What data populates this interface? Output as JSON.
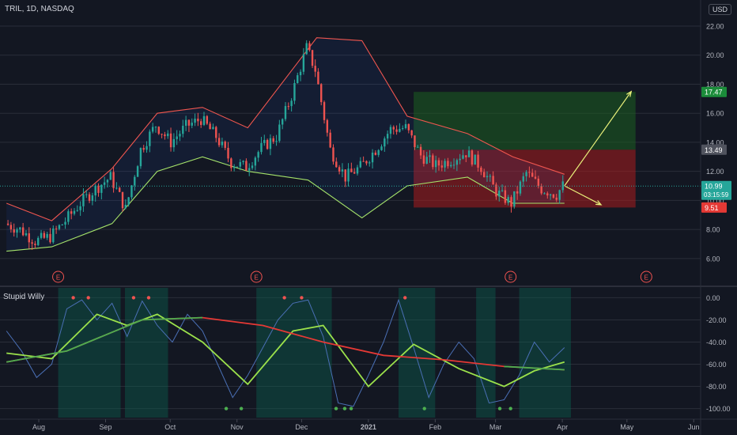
{
  "header": {
    "symbol": "TRIL, 1D, NASDAQ",
    "currency": "USD"
  },
  "indicator": {
    "title": "Stupid Willy"
  },
  "price_badges": {
    "target": "17.47",
    "level": "13.49",
    "current": "10.99",
    "countdown": "03:15:59",
    "stop": "9.51"
  },
  "earnings_marker": "E",
  "x_axis": {
    "labels": [
      "Aug",
      "Sep",
      "Oct",
      "Nov",
      "Dec",
      "2021",
      "Feb",
      "Mar",
      "Apr",
      "May",
      "Jun"
    ]
  },
  "colors": {
    "background": "#131722",
    "up": "#26a69a",
    "down": "#ef5350",
    "upper_band": "#f0564f",
    "lower_band": "#a5e36a",
    "target_zone": "#1b5e20",
    "stop_zone": "#b71c1c",
    "willy_line": "#4a6fb5",
    "grid": "#2a2e39"
  },
  "chart_data": [
    {
      "type": "candlestick",
      "title": "TRIL, 1D, NASDAQ",
      "y_axis_ticks": [
        "22.00",
        "20.00",
        "18.00",
        "16.00",
        "14.00",
        "12.00",
        "10.00",
        "8.00",
        "6.00"
      ],
      "ylim": [
        5.5,
        22.6
      ],
      "x_ticks": [
        "Aug",
        "Sep",
        "Oct",
        "Nov",
        "Dec",
        "2021",
        "Feb",
        "Mar",
        "Apr",
        "May",
        "Jun"
      ],
      "close_path": [
        [
          "2020-07-17",
          8.4
        ],
        [
          "2020-07-24",
          8.0
        ],
        [
          "2020-07-31",
          7.2
        ],
        [
          "2020-08-07",
          7.5
        ],
        [
          "2020-08-14",
          8.6
        ],
        [
          "2020-08-21",
          9.8
        ],
        [
          "2020-08-28",
          10.8
        ],
        [
          "2020-09-04",
          11.6
        ],
        [
          "2020-09-11",
          9.4
        ],
        [
          "2020-09-18",
          13.5
        ],
        [
          "2020-09-25",
          15.2
        ],
        [
          "2020-10-02",
          14.0
        ],
        [
          "2020-10-09",
          15.1
        ],
        [
          "2020-10-16",
          15.6
        ],
        [
          "2020-10-23",
          14.4
        ],
        [
          "2020-10-30",
          12.6
        ],
        [
          "2020-11-06",
          12.3
        ],
        [
          "2020-11-13",
          13.6
        ],
        [
          "2020-11-20",
          14.4
        ],
        [
          "2020-11-27",
          17.2
        ],
        [
          "2020-12-04",
          20.5
        ],
        [
          "2020-12-08",
          19.0
        ],
        [
          "2020-12-15",
          13.5
        ],
        [
          "2020-12-22",
          11.6
        ],
        [
          "2020-12-29",
          12.3
        ],
        [
          "2021-01-05",
          13.5
        ],
        [
          "2021-01-12",
          14.9
        ],
        [
          "2021-01-19",
          15.0
        ],
        [
          "2021-01-26",
          13.1
        ],
        [
          "2021-02-02",
          12.4
        ],
        [
          "2021-02-09",
          12.8
        ],
        [
          "2021-02-16",
          13.3
        ],
        [
          "2021-02-23",
          12.3
        ],
        [
          "2021-03-02",
          10.6
        ],
        [
          "2021-03-09",
          9.8
        ],
        [
          "2021-03-16",
          11.9
        ],
        [
          "2021-03-23",
          10.8
        ],
        [
          "2021-03-30",
          10.4
        ],
        [
          "2021-04-02",
          11.0
        ]
      ],
      "upper_band": [
        [
          "2020-07-17",
          9.8
        ],
        [
          "2020-08-07",
          8.6
        ],
        [
          "2020-09-04",
          12.2
        ],
        [
          "2020-09-25",
          16.0
        ],
        [
          "2020-10-16",
          16.4
        ],
        [
          "2020-11-06",
          15.0
        ],
        [
          "2020-12-08",
          21.2
        ],
        [
          "2020-12-29",
          21.0
        ],
        [
          "2021-01-19",
          15.8
        ],
        [
          "2021-02-16",
          14.6
        ],
        [
          "2021-03-09",
          13.0
        ],
        [
          "2021-04-02",
          11.8
        ]
      ],
      "lower_band": [
        [
          "2020-07-17",
          6.5
        ],
        [
          "2020-08-07",
          6.8
        ],
        [
          "2020-09-04",
          8.4
        ],
        [
          "2020-09-25",
          12.0
        ],
        [
          "2020-10-16",
          13.0
        ],
        [
          "2020-11-06",
          12.0
        ],
        [
          "2020-12-04",
          11.4
        ],
        [
          "2020-12-29",
          8.8
        ],
        [
          "2021-01-19",
          11.0
        ],
        [
          "2021-02-16",
          11.6
        ],
        [
          "2021-03-09",
          9.8
        ],
        [
          "2021-04-02",
          9.8
        ]
      ],
      "position": {
        "entry": 13.49,
        "target": 17.47,
        "stop": 9.51,
        "start": "2021-01-22",
        "end": "2021-05-05",
        "projection_up": [
          [
            "2021-04-02",
            11.0
          ],
          [
            "2021-05-03",
            17.5
          ]
        ],
        "projection_down": [
          [
            "2021-04-02",
            11.0
          ],
          [
            "2021-04-19",
            9.7
          ]
        ]
      },
      "earnings_dates": [
        "2020-08-10",
        "2020-11-10",
        "2021-03-08",
        "2021-05-10"
      ],
      "last_price": 10.99,
      "countdown": "03:15:59"
    },
    {
      "type": "line",
      "title": "Stupid Willy",
      "y_axis_ticks": [
        "0.00",
        "-20.00",
        "-40.00",
        "-60.00",
        "-80.00",
        "-100.00"
      ],
      "ylim": [
        -106,
        6
      ],
      "series": [
        {
          "values": [
            [
              "2020-07-17",
              -30
            ],
            [
              "2020-07-24",
              -48
            ],
            [
              "2020-07-31",
              -72
            ],
            [
              "2020-08-07",
              -60
            ],
            [
              "2020-08-14",
              -10
            ],
            [
              "2020-08-21",
              -2
            ],
            [
              "2020-08-28",
              -20
            ],
            [
              "2020-09-04",
              -5
            ],
            [
              "2020-09-11",
              -35
            ],
            [
              "2020-09-18",
              -3
            ],
            [
              "2020-09-25",
              -25
            ],
            [
              "2020-10-02",
              -40
            ],
            [
              "2020-10-09",
              -15
            ],
            [
              "2020-10-16",
              -30
            ],
            [
              "2020-10-23",
              -60
            ],
            [
              "2020-10-30",
              -90
            ],
            [
              "2020-11-06",
              -70
            ],
            [
              "2020-11-13",
              -45
            ],
            [
              "2020-11-20",
              -20
            ],
            [
              "2020-11-27",
              -5
            ],
            [
              "2020-12-04",
              -2
            ],
            [
              "2020-12-11",
              -35
            ],
            [
              "2020-12-18",
              -95
            ],
            [
              "2020-12-25",
              -98
            ],
            [
              "2021-01-01",
              -70
            ],
            [
              "2021-01-08",
              -40
            ],
            [
              "2021-01-15",
              -2
            ],
            [
              "2021-01-22",
              -45
            ],
            [
              "2021-01-29",
              -90
            ],
            [
              "2021-02-05",
              -60
            ],
            [
              "2021-02-12",
              -40
            ],
            [
              "2021-02-19",
              -55
            ],
            [
              "2021-02-26",
              -95
            ],
            [
              "2021-03-05",
              -92
            ],
            [
              "2021-03-12",
              -70
            ],
            [
              "2021-03-19",
              -40
            ],
            [
              "2021-03-26",
              -58
            ],
            [
              "2021-04-02",
              -45
            ]
          ]
        },
        {
          "values": [
            [
              "2020-07-17",
              -50
            ],
            [
              "2020-08-07",
              -55
            ],
            [
              "2020-08-28",
              -15
            ],
            [
              "2020-09-11",
              -25
            ],
            [
              "2020-09-25",
              -15
            ],
            [
              "2020-10-16",
              -40
            ],
            [
              "2020-11-06",
              -78
            ],
            [
              "2020-11-27",
              -30
            ],
            [
              "2020-12-11",
              -25
            ],
            [
              "2021-01-01",
              -80
            ],
            [
              "2021-01-22",
              -42
            ],
            [
              "2021-02-12",
              -64
            ],
            [
              "2021-03-05",
              -80
            ],
            [
              "2021-03-19",
              -66
            ],
            [
              "2021-04-02",
              -58
            ]
          ]
        },
        {
          "values": [
            [
              "2020-07-17",
              -58
            ],
            [
              "2020-08-14",
              -48
            ],
            [
              "2020-09-18",
              -20
            ],
            [
              "2020-10-16",
              -18
            ],
            [
              "2020-11-13",
              -25
            ],
            [
              "2020-12-11",
              -40
            ],
            [
              "2021-01-08",
              -52
            ],
            [
              "2021-02-05",
              -56
            ],
            [
              "2021-03-05",
              -62
            ],
            [
              "2021-04-02",
              -65
            ]
          ]
        }
      ]
    }
  ]
}
